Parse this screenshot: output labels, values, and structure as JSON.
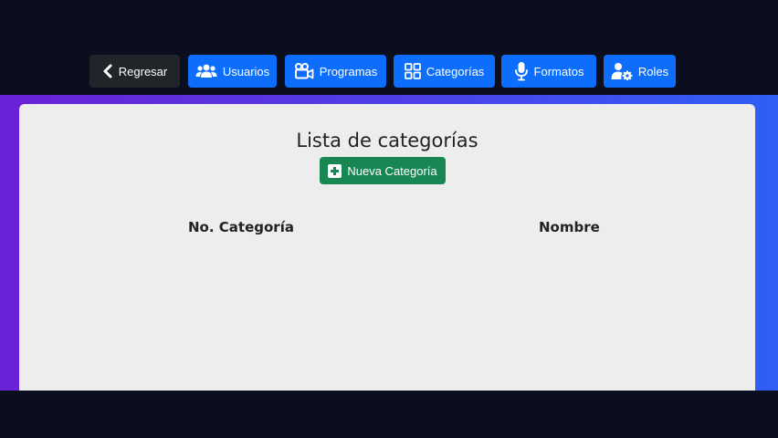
{
  "nav": {
    "back_label": "Regresar",
    "items": [
      {
        "label": "Usuarios",
        "icon": "users-icon"
      },
      {
        "label": "Programas",
        "icon": "video-camera-icon"
      },
      {
        "label": "Categorías",
        "icon": "grid-icon"
      },
      {
        "label": "Formatos",
        "icon": "microphone-icon"
      },
      {
        "label": "Roles",
        "icon": "user-gear-icon"
      }
    ]
  },
  "main": {
    "title": "Lista de categorías",
    "new_button_label": "Nueva Categoría",
    "table": {
      "headers": [
        "No. Categoría",
        "Nombre"
      ],
      "rows": []
    }
  },
  "colors": {
    "background": "#0b0e1e",
    "primary": "#0d6efd",
    "dark_button": "#212529",
    "success": "#198754",
    "card": "#ededed",
    "gradient_start": "#6b21d6",
    "gradient_end": "#2f5ff5"
  }
}
